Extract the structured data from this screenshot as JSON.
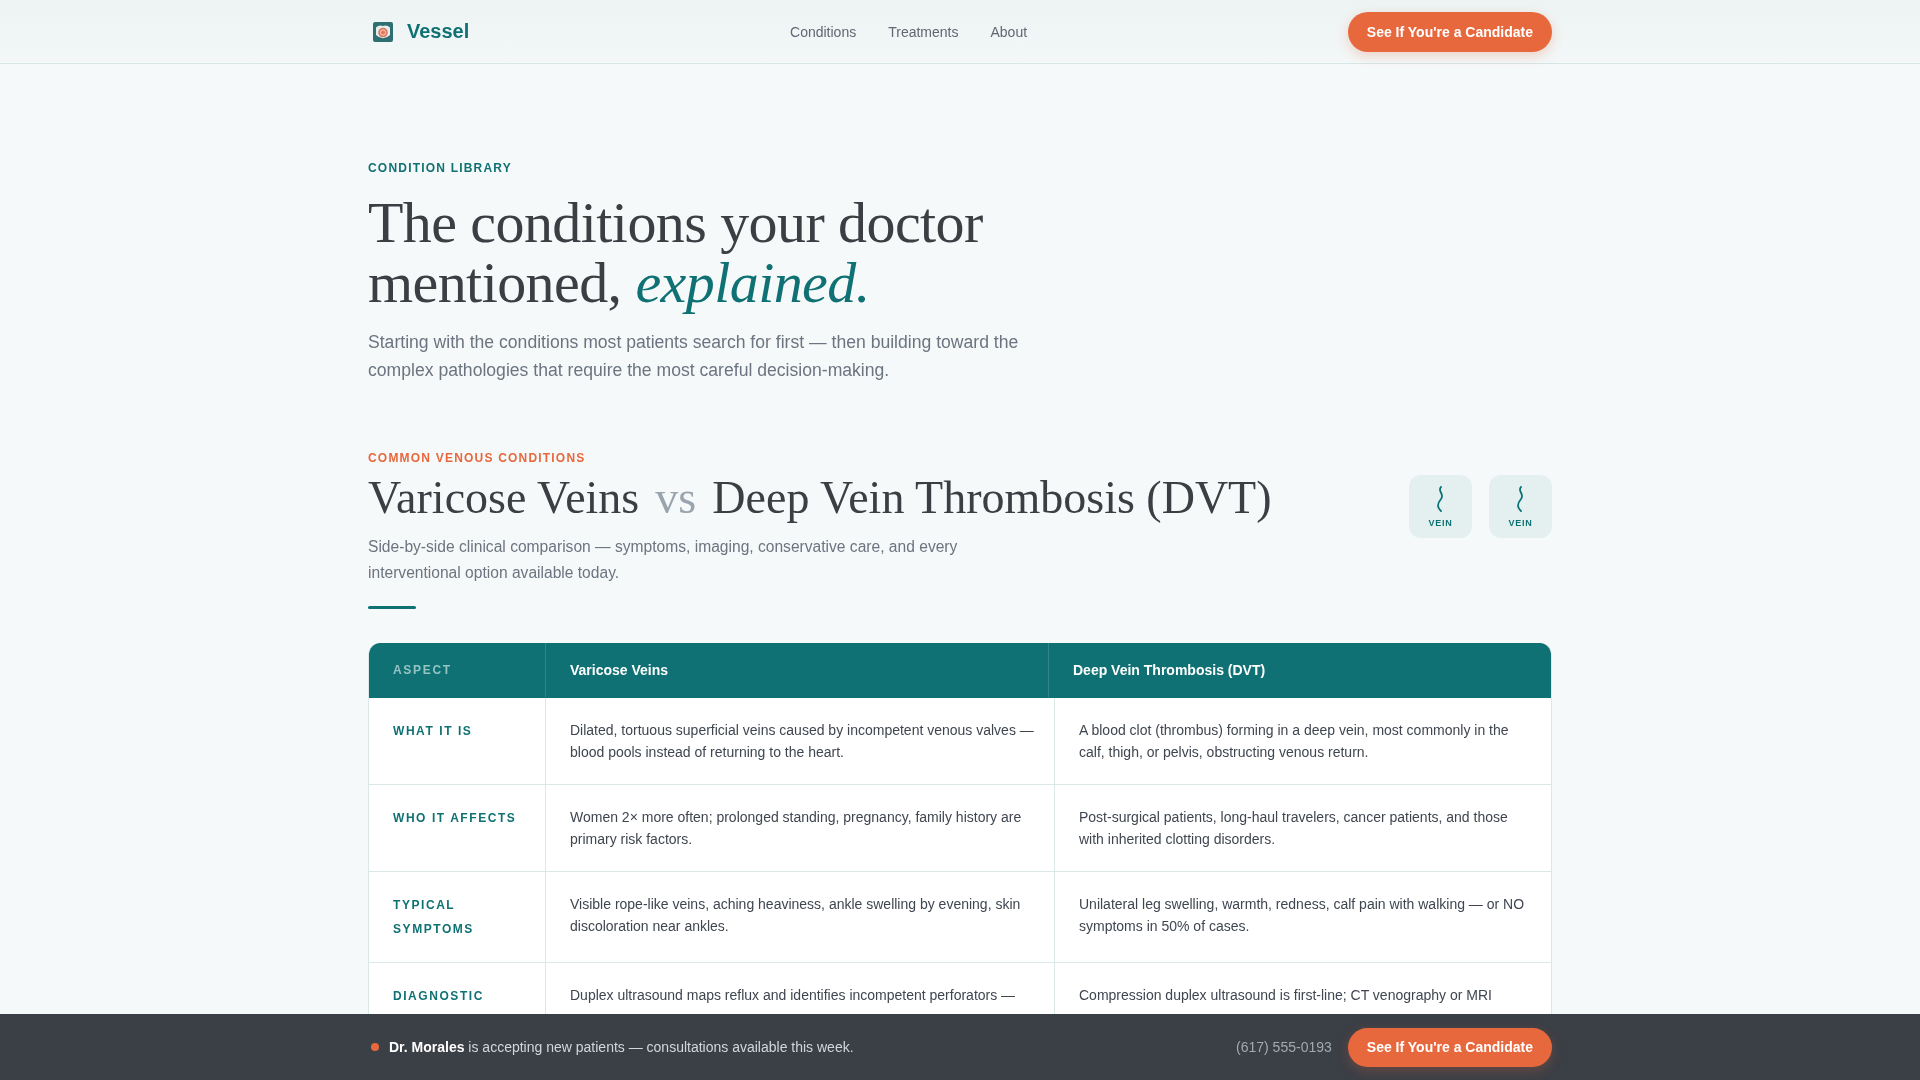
{
  "header": {
    "brand": "Vessel",
    "nav": [
      {
        "label": "Conditions"
      },
      {
        "label": "Treatments"
      },
      {
        "label": "About"
      }
    ],
    "cta": "See If You're a Candidate"
  },
  "hero": {
    "eyebrow": "CONDITION LIBRARY",
    "title": "The conditions your doctor mentioned, *explained.*",
    "subtitle": "Starting with the conditions most patients search for first — then building toward the complex pathologies that require the most careful decision-making."
  },
  "section": {
    "eyebrow": "COMMON VENOUS CONDITIONS",
    "title": {
      "left": "Varicose Veins",
      "joiner": "vs",
      "right": "Deep Vein Thrombosis (DVT)"
    },
    "description": "Side-by-side clinical comparison — symptoms, imaging, conservative care, and every interventional option available today.",
    "tiles": [
      {
        "label": "VEIN"
      },
      {
        "label": "VEIN"
      }
    ]
  },
  "table": {
    "columns": [
      "ASPECT",
      "Varicose Veins",
      "Deep Vein Thrombosis (DVT)"
    ],
    "rows": [
      {
        "cells": [
          "WHAT IT IS",
          "Dilated, tortuous superficial veins caused by incompetent venous valves — blood pools instead of returning to the heart.",
          "A blood clot (thrombus) forming in a deep vein, most commonly in the calf, thigh, or pelvis, obstructing venous return."
        ]
      },
      {
        "cells": [
          "WHO IT AFFECTS",
          "Women 2× more often; prolonged standing, pregnancy, family history are primary risk factors.",
          "Post-surgical patients, long-haul travelers, cancer patients, and those with inherited clotting disorders."
        ]
      },
      {
        "cells": [
          "TYPICAL SYMPTOMS",
          "Visible rope-like veins, aching heaviness, ankle swelling by evening, skin discoloration near ankles.",
          "Unilateral leg swelling, warmth, redness, calf pain with walking — or NO symptoms in 50% of cases."
        ]
      },
      {
        "cells": [
          "DIAGNOSTIC",
          "Duplex ultrasound maps reflux and identifies incompetent perforators —",
          "Compression duplex ultrasound is first-line; CT venography or MRI"
        ]
      }
    ]
  },
  "bottom_bar": {
    "message": "**Dr. Morales** is accepting new patients — consultations available this week.",
    "phone": "(617) 555-0193",
    "cta": "See If You're a Candidate"
  }
}
